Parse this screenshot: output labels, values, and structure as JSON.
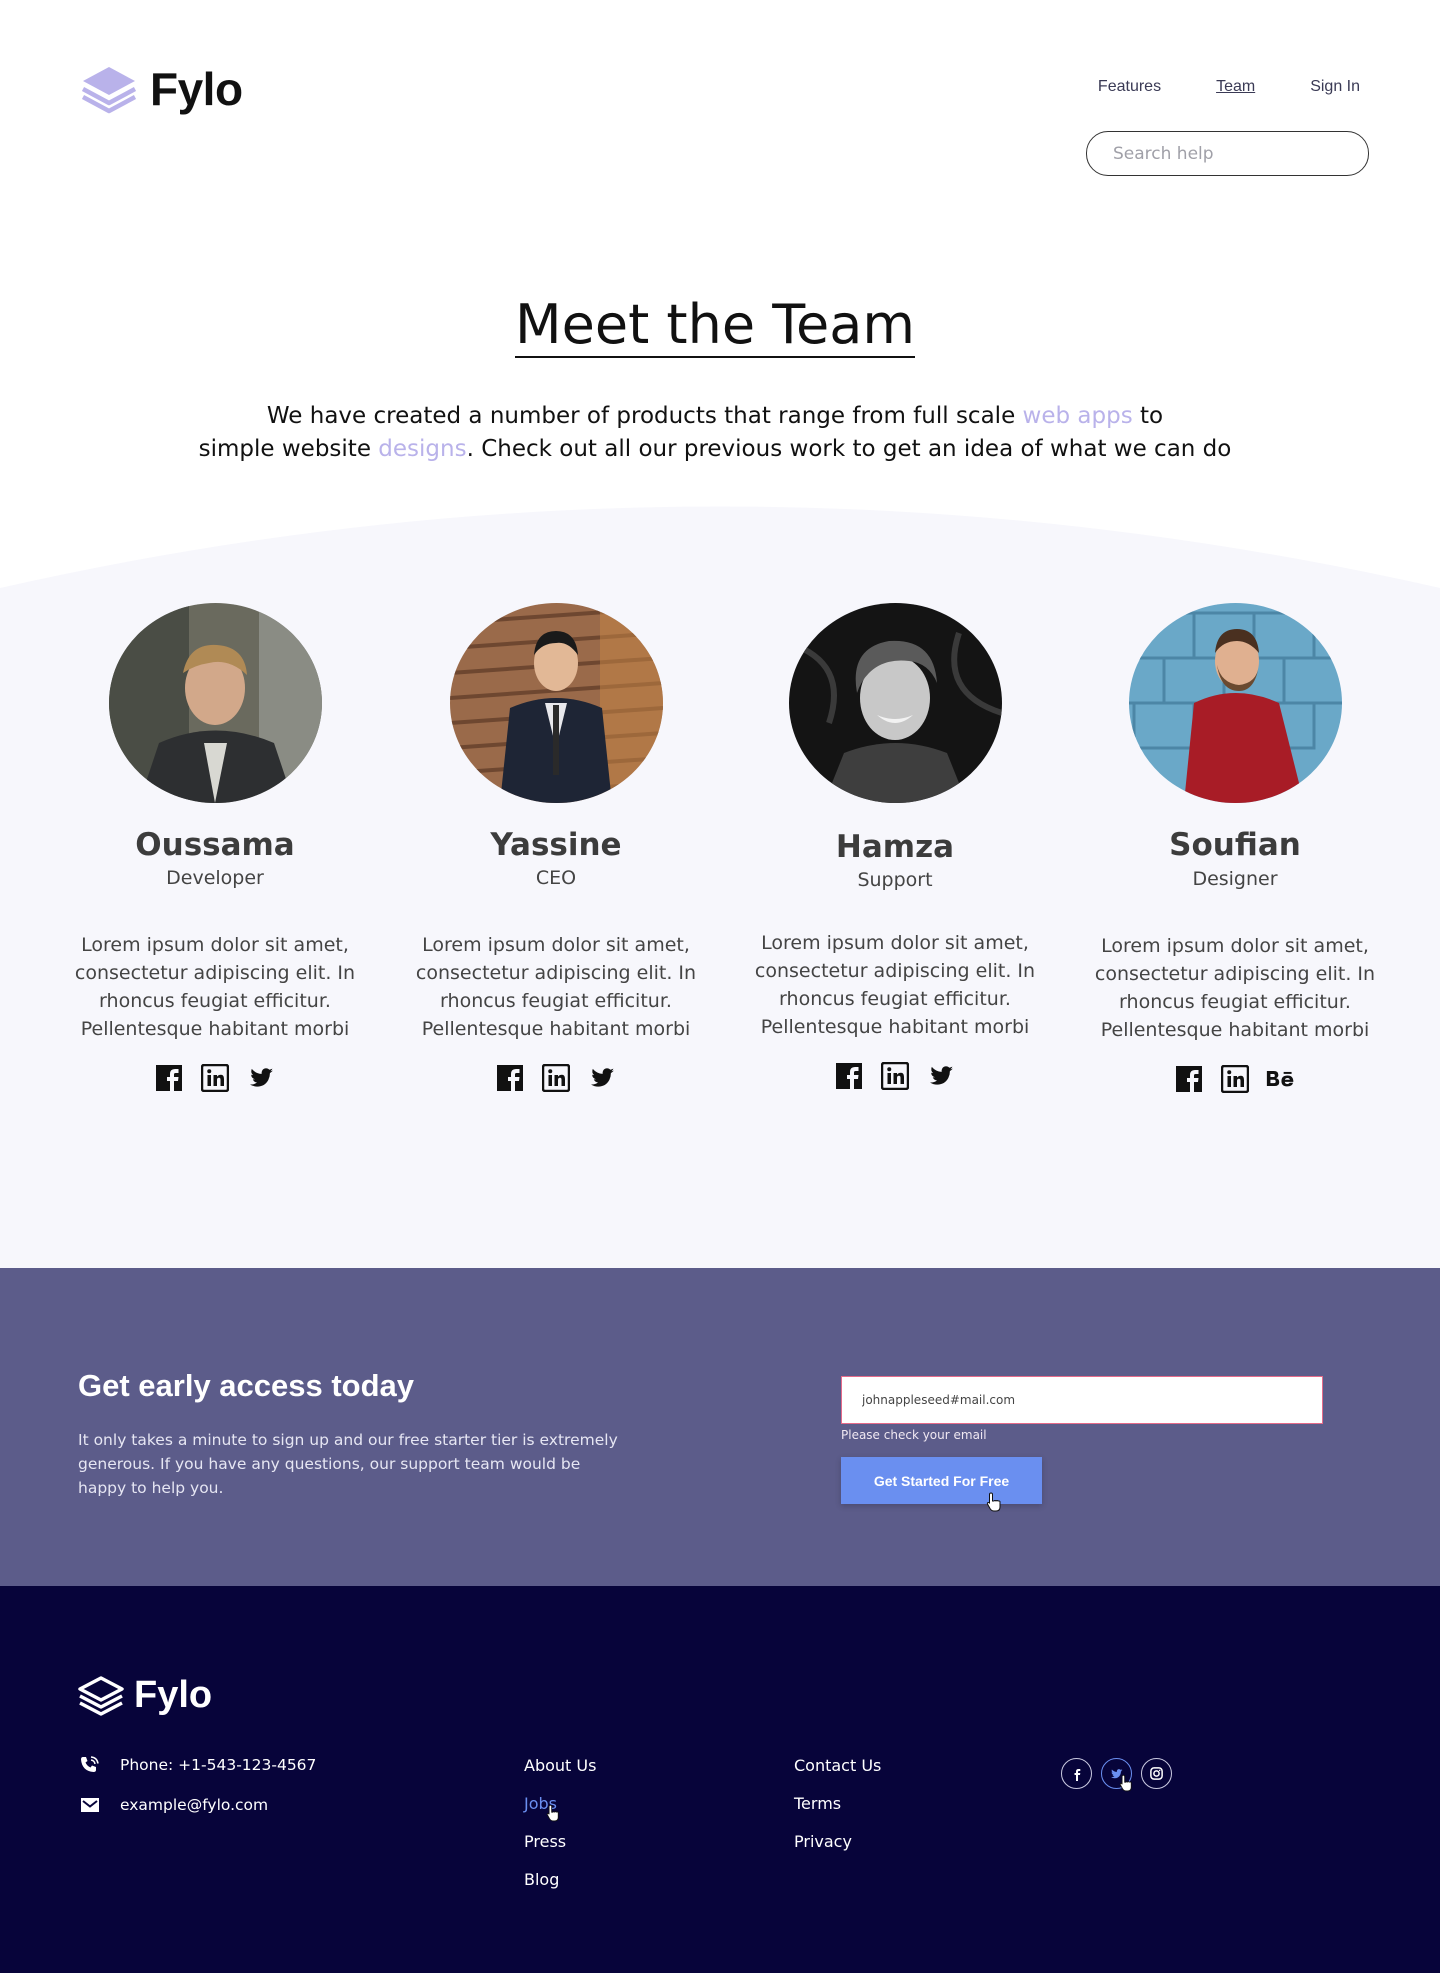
{
  "header": {
    "brand": "Fylo",
    "nav": [
      {
        "label": "Features"
      },
      {
        "label": "Team"
      },
      {
        "label": "Sign In"
      }
    ],
    "search_placeholder": "Search help"
  },
  "hero": {
    "title": "Meet the Team",
    "desc_part1": "We have created a number of products that range from full scale ",
    "desc_highlight1": "web apps",
    "desc_part2": " to",
    "desc_part3": "simple website ",
    "desc_highlight2": "designs",
    "desc_part4": ". Check out all our previous work to get an idea of what we can do"
  },
  "team": [
    {
      "name": "Oussama",
      "role": "Developer",
      "bio": "Lorem ipsum dolor sit amet, consectetur adipiscing elit. In rhoncus feugiat efficitur. Pellentesque habitant morbi",
      "socials": [
        "facebook-icon",
        "linkedin-icon",
        "twitter-icon"
      ]
    },
    {
      "name": "Yassine",
      "role": "CEO",
      "bio": "Lorem ipsum dolor sit amet, consectetur adipiscing elit. In rhoncus feugiat efficitur. Pellentesque habitant morbi",
      "socials": [
        "facebook-icon",
        "linkedin-icon",
        "twitter-icon"
      ]
    },
    {
      "name": "Hamza",
      "role": "Support",
      "bio": "Lorem ipsum dolor sit amet, consectetur adipiscing elit. In rhoncus feugiat efficitur. Pellentesque habitant morbi",
      "socials": [
        "facebook-icon",
        "linkedin-icon",
        "twitter-icon"
      ]
    },
    {
      "name": "Soufian",
      "role": "Designer",
      "bio": "Lorem ipsum dolor sit amet, consectetur adipiscing elit. In rhoncus feugiat efficitur. Pellentesque habitant morbi",
      "socials": [
        "facebook-icon",
        "linkedin-icon",
        "behance-icon"
      ]
    }
  ],
  "cta": {
    "title": "Get early access today",
    "text": "It only takes a minute to sign up and our free starter tier is extremely generous. If you have any questions, our support team would be happy to help you.",
    "email_value": "johnappleseed#mail.com",
    "error": "Please check your email",
    "button": "Get Started For Free"
  },
  "footer": {
    "brand": "Fylo",
    "phone": "Phone: +1-543-123-4567",
    "email": "example@fylo.com",
    "col1": [
      "About Us",
      "Jobs",
      "Press",
      "Blog"
    ],
    "col2": [
      "Contact Us",
      "Terms",
      "Privacy"
    ],
    "socials": [
      "facebook-icon",
      "twitter-icon",
      "instagram-icon"
    ]
  },
  "colors": {
    "accent": "#b9b2ea",
    "band": "#f7f7fc",
    "cta_bg": "#5c5c8a",
    "button": "#6a8ff0",
    "footer_bg": "#07043a"
  }
}
